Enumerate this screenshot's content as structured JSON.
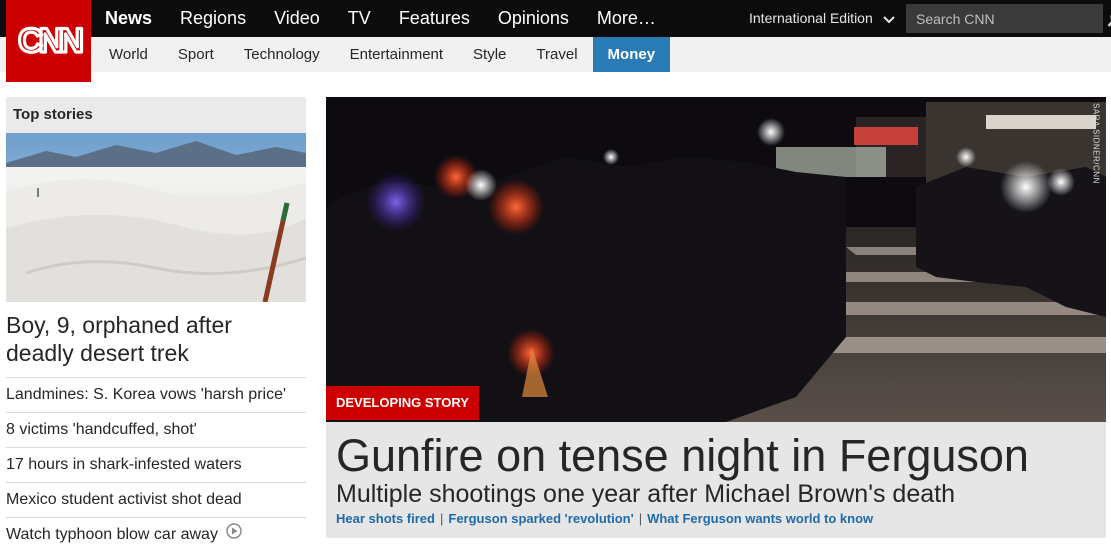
{
  "brand": {
    "logo_text": "CNN",
    "brand_color": "#cc0000"
  },
  "main_nav": [
    {
      "label": "News",
      "active": true
    },
    {
      "label": "Regions"
    },
    {
      "label": "Video"
    },
    {
      "label": "TV"
    },
    {
      "label": "Features"
    },
    {
      "label": "Opinions"
    },
    {
      "label": "More…"
    }
  ],
  "edition": {
    "label": "International Edition",
    "icon": "chevron-down-icon"
  },
  "search": {
    "placeholder": "Search CNN",
    "icon": "search-icon"
  },
  "sub_nav": [
    {
      "label": "World"
    },
    {
      "label": "Sport"
    },
    {
      "label": "Technology"
    },
    {
      "label": "Entertainment"
    },
    {
      "label": "Style"
    },
    {
      "label": "Travel"
    },
    {
      "label": "Money",
      "active": true
    }
  ],
  "top_stories": {
    "heading": "Top stories",
    "lead_headline": "Boy, 9, orphaned after deadly desert trek",
    "items": [
      {
        "label": "Landmines: S. Korea vows 'harsh price'"
      },
      {
        "label": "8 victims 'handcuffed, shot'"
      },
      {
        "label": "17 hours in shark-infested waters"
      },
      {
        "label": "Mexico student activist shot dead"
      },
      {
        "label": "Watch typhoon blow car away",
        "icon": "play-icon"
      }
    ]
  },
  "hero": {
    "badge": "DEVELOPING STORY",
    "photo_credit": "SARA SIDNER/CNN",
    "title": "Gunfire on tense night in Ferguson",
    "subtitle": "Multiple shootings one year after Michael Brown's death",
    "links": [
      {
        "label": "Hear shots fired"
      },
      {
        "label": "Ferguson sparked 'revolution'"
      },
      {
        "label": "What Ferguson wants world to know"
      }
    ],
    "link_color": "#1f6aa8",
    "badge_color": "#cc0000"
  }
}
